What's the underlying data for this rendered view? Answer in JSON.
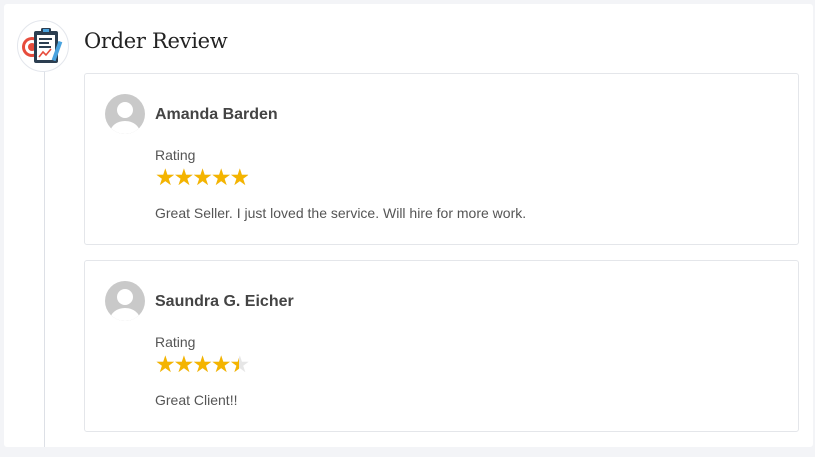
{
  "section": {
    "title": "Order Review",
    "icon": "clipboard-chart-icon"
  },
  "colors": {
    "star": "#f4b400",
    "star_empty": "#e6e6e6",
    "card_border": "#e4e6ea"
  },
  "reviews": [
    {
      "name": "Amanda Barden",
      "rating_label": "Rating",
      "rating": 5,
      "rating_max": 5,
      "comment": "Great Seller. I just loved the service. Will hire for more work."
    },
    {
      "name": "Saundra G. Eicher",
      "rating_label": "Rating",
      "rating": 4.5,
      "rating_max": 5,
      "comment": "Great Client!!"
    }
  ]
}
